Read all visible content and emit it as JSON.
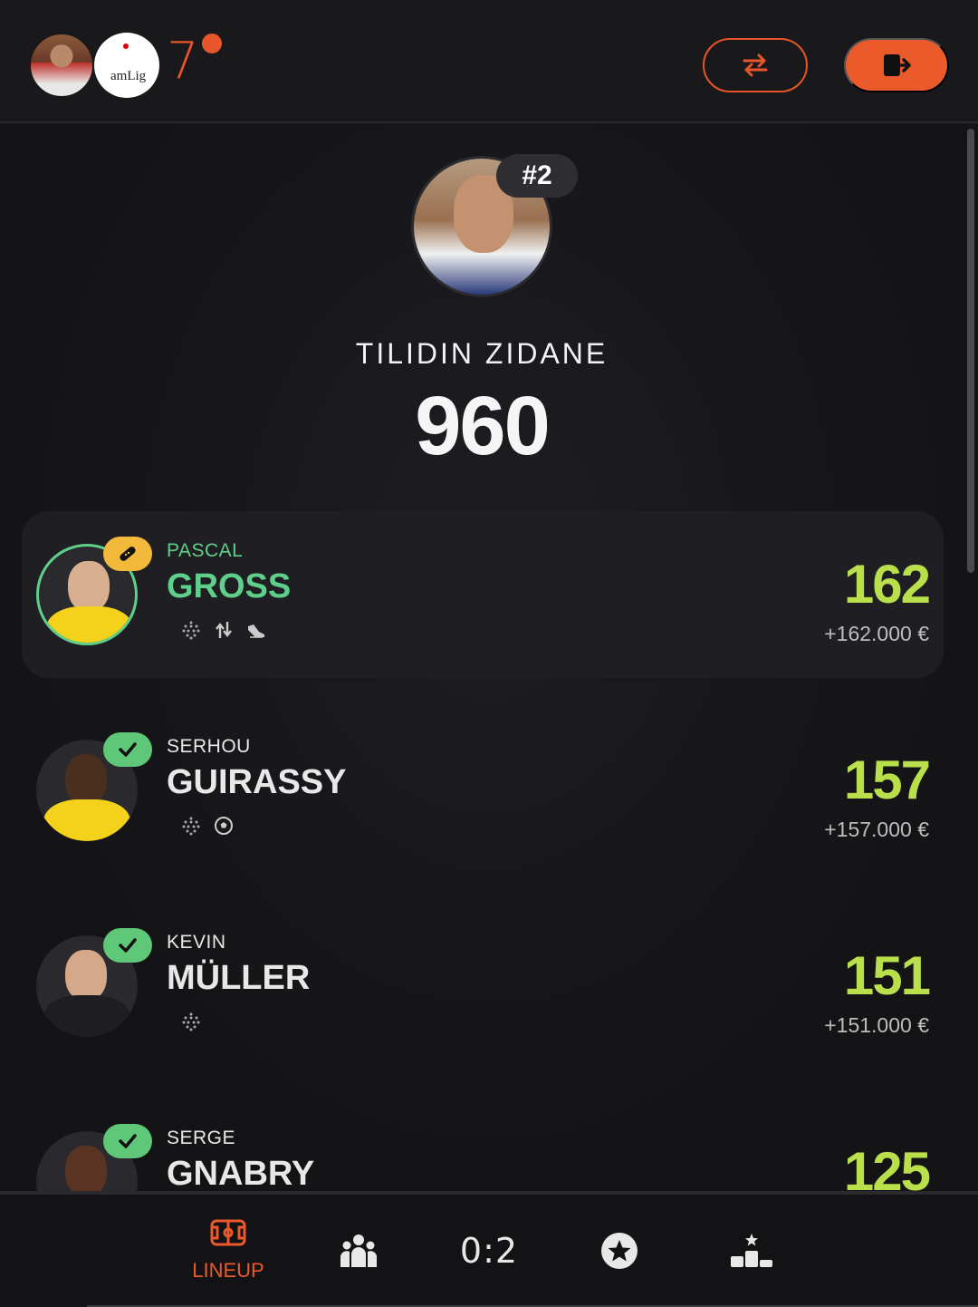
{
  "header": {
    "league_badge_text": "amLig",
    "round_number": "7",
    "accent_color": "#e8552a"
  },
  "manager": {
    "rank": "#2",
    "name": "TILIDIN ZIDANE",
    "total_points": "960"
  },
  "players": [
    {
      "first_name": "PASCAL",
      "last_name": "GROSS",
      "points": "162",
      "value": "+162.000 €",
      "status": "injury",
      "icons": [
        "formation-icon",
        "substitution-icon",
        "boot-icon"
      ],
      "active": true
    },
    {
      "first_name": "SERHOU",
      "last_name": "GUIRASSY",
      "points": "157",
      "value": "+157.000 €",
      "status": "confirmed",
      "icons": [
        "formation-icon",
        "ball-icon"
      ],
      "active": false
    },
    {
      "first_name": "KEVIN",
      "last_name": "MÜLLER",
      "points": "151",
      "value": "+151.000 €",
      "status": "confirmed",
      "icons": [
        "formation-icon"
      ],
      "active": false
    },
    {
      "first_name": "SERGE",
      "last_name": "GNABRY",
      "points": "125",
      "value": "",
      "status": "confirmed",
      "icons": [],
      "active": false
    }
  ],
  "nav": {
    "lineup_label": "LINEUP",
    "score": "0:2",
    "items": [
      "lineup-icon",
      "team-icon",
      "score",
      "star-icon",
      "podium-icon"
    ]
  }
}
